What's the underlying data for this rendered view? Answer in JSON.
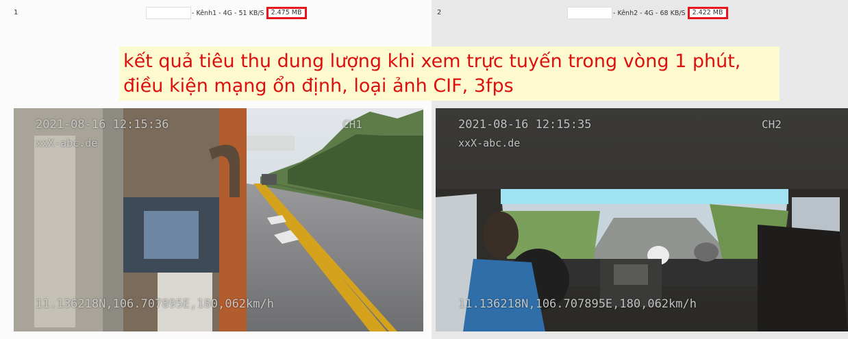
{
  "note": {
    "line1": "kết quả tiêu thụ dung lượng khi xem trực tuyến trong vòng 1 phút,",
    "line2": "điều kiện mạng ổn định, loại ảnh CIF, 3fps"
  },
  "channels": [
    {
      "index": "1",
      "title": "- Kênh1 - 4G - 51 KB/S",
      "data_used": "2.475 MB",
      "osd": {
        "timestamp": "2021-08-16 12:15:36",
        "watermark": "xxX-abc.de",
        "channel": "CH1",
        "gps": "11.136218N,106.707895E,180,062km/h"
      }
    },
    {
      "index": "2",
      "title": "- Kênh2 - 4G - 68 KB/S",
      "data_used": "2.422 MB",
      "osd": {
        "timestamp": "2021-08-16 12:15:35",
        "watermark": "xxX-abc.de",
        "channel": "CH2",
        "gps": "11.136218N,106.707895E,180,062km/h"
      }
    }
  ],
  "colors": {
    "highlight_border": "#e8141c",
    "note_background": "#fefad0",
    "note_text": "#dd1010"
  }
}
